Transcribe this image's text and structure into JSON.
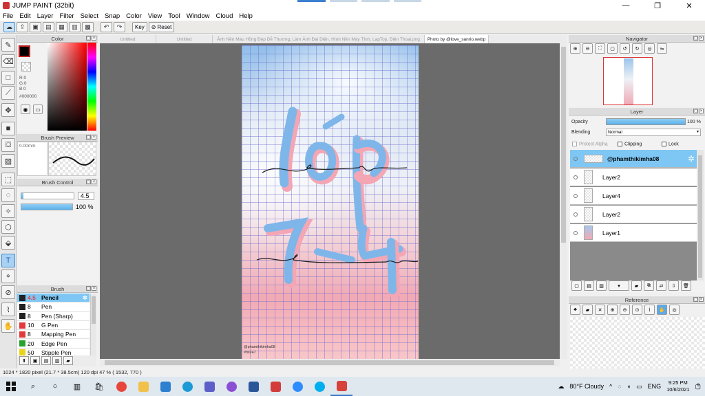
{
  "window": {
    "title": "JUMP PAINT (32bit)",
    "minimize": "—",
    "maximize": "❐",
    "close": "✕"
  },
  "menu": [
    "File",
    "Edit",
    "Layer",
    "Filter",
    "Select",
    "Snap",
    "Color",
    "View",
    "Tool",
    "Window",
    "Cloud",
    "Help"
  ],
  "toolbar": {
    "key_label": "Key",
    "reset_label": "Reset"
  },
  "color_panel": {
    "title": "Color",
    "r": "R:0",
    "g": "G:0",
    "b": "B:0",
    "hex": "#000000",
    "fg_color": "#000000"
  },
  "brush_preview": {
    "title": "Brush Preview",
    "size": "0.00mm"
  },
  "brush_control": {
    "title": "Brush Control",
    "size_value": "4.5",
    "opacity_value": "100 %",
    "opacity": 1.0
  },
  "brush_panel": {
    "title": "Brush",
    "items": [
      {
        "size": "4.5",
        "name": "Pencil",
        "color": "#222222",
        "selected": true
      },
      {
        "size": "8",
        "name": "Pen",
        "color": "#222222"
      },
      {
        "size": "8",
        "name": "Pen (Sharp)",
        "color": "#222222"
      },
      {
        "size": "10",
        "name": "G Pen",
        "color": "#e03a3a"
      },
      {
        "size": "8",
        "name": "Mapping Pen",
        "color": "#e03a3a"
      },
      {
        "size": "20",
        "name": "Edge Pen",
        "color": "#27a22f"
      },
      {
        "size": "50",
        "name": "Stipple Pen",
        "color": "#e8d41c"
      }
    ]
  },
  "tabs": [
    {
      "label": "Untitled"
    },
    {
      "label": "Untitled"
    },
    {
      "label": "Ảnh Nền Màu Hồng Đẹp Dễ Thương, Làm Ảnh Đại Diện, Hình Nền Máy Tính, LapTop, Điện Thoại.png"
    },
    {
      "label": "Photo by @love_sanrio.webp",
      "active": true
    }
  ],
  "artwork": {
    "watermark_line1": "@phamthikimha08",
    "watermark_line2": "#fxl247"
  },
  "navigator": {
    "title": "Navigator"
  },
  "layer_panel": {
    "title": "Layer",
    "opacity_label": "Opacity",
    "opacity_value": "100 %",
    "blending_label": "Blending",
    "blending_value": "Normal",
    "protect_alpha": "Protect Alpha",
    "clipping": "Clipping",
    "lock": "Lock",
    "layers": [
      {
        "name": "@phamthikimha08",
        "selected": true
      },
      {
        "name": "Layer2"
      },
      {
        "name": "Layer4"
      },
      {
        "name": "Layer2"
      },
      {
        "name": "Layer1"
      }
    ]
  },
  "reference": {
    "title": "Reference"
  },
  "status_bar": {
    "text": "1024 * 1820 pixel   (21.7 * 38.5cm)   120 dpi   47 %   ( 1532, 770 )"
  },
  "taskbar": {
    "weather": "80°F  Cloudy",
    "lang": "ENG",
    "time": "9:25 PM",
    "date": "10/6/2021",
    "notifications": "9",
    "apps": [
      {
        "name": "chrome",
        "color": "#e8453c"
      },
      {
        "name": "file-explorer",
        "color": "#f2c14a"
      },
      {
        "name": "mail",
        "color": "#2d7fd0"
      },
      {
        "name": "edge",
        "color": "#1b9ad6"
      },
      {
        "name": "teams",
        "color": "#5b5fc7"
      },
      {
        "name": "messenger",
        "color": "#8a4fd3"
      },
      {
        "name": "word",
        "color": "#2b579a"
      },
      {
        "name": "firealpaca",
        "color": "#d43b3b"
      },
      {
        "name": "zoom",
        "color": "#2d8cff"
      },
      {
        "name": "skype",
        "color": "#00aff0"
      },
      {
        "name": "jump-paint",
        "color": "#d7433b"
      }
    ]
  }
}
